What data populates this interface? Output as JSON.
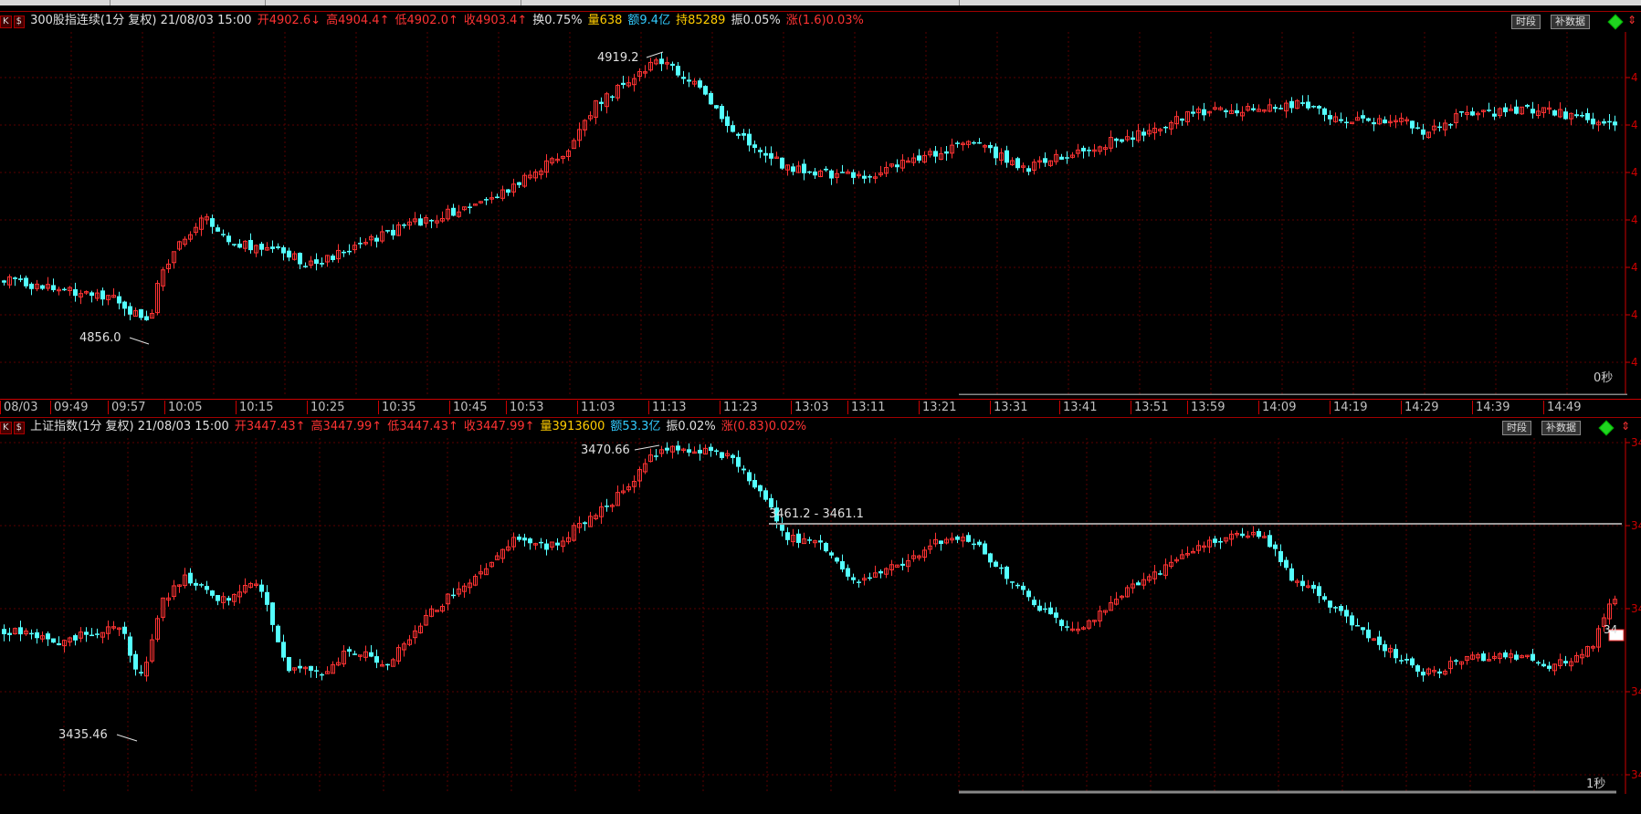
{
  "top_panel": {
    "tags": [
      "K",
      "$"
    ],
    "title": "300股指连续(1分  复权) 21/08/03 15:00",
    "stats": [
      {
        "text": "开4902.6↓",
        "color": "#ff3333"
      },
      {
        "text": "高4904.4↑",
        "color": "#ff3333"
      },
      {
        "text": "低4902.0↑",
        "color": "#ff3333"
      },
      {
        "text": "收4903.4↑",
        "color": "#ff3333"
      },
      {
        "text": "换0.75%",
        "color": "#e0e0e0"
      },
      {
        "text": "量638",
        "color": "#ffcc00"
      },
      {
        "text": "额9.4亿",
        "color": "#33ccff"
      },
      {
        "text": "持85289",
        "color": "#ffcc00"
      },
      {
        "text": "振0.05%",
        "color": "#e0e0e0"
      },
      {
        "text": "涨(1.6)0.03%",
        "color": "#ff3333"
      }
    ],
    "btn_period": "时段",
    "btn_supplement": "补数据",
    "high_label": "4919.2",
    "low_label": "4856.0",
    "corner": "0秒",
    "axis_ticks": [
      "08/03",
      "09:49",
      "09:57",
      "10:05",
      "10:15",
      "10:25",
      "10:35",
      "10:45",
      "10:53",
      "11:03",
      "11:13",
      "11:23",
      "13:03",
      "13:11",
      "13:21",
      "13:31",
      "13:41",
      "13:51",
      "13:59",
      "14:09",
      "14:19",
      "14:29",
      "14:39",
      "14:49"
    ],
    "right_axis_labels": [
      "4",
      "4",
      "4",
      "4",
      "4",
      "4",
      "4"
    ]
  },
  "bottom_panel": {
    "tags": [
      "K",
      "$"
    ],
    "title": "上证指数(1分  复权) 21/08/03 15:00",
    "stats": [
      {
        "text": "开3447.43↑",
        "color": "#ff3333"
      },
      {
        "text": "高3447.99↑",
        "color": "#ff3333"
      },
      {
        "text": "低3447.43↑",
        "color": "#ff3333"
      },
      {
        "text": "收3447.99↑",
        "color": "#ff3333"
      },
      {
        "text": "量3913600",
        "color": "#ffcc00"
      },
      {
        "text": "额53.3亿",
        "color": "#33ccff"
      },
      {
        "text": "振0.02%",
        "color": "#e0e0e0"
      },
      {
        "text": "涨(0.83)0.02%",
        "color": "#ff3333"
      }
    ],
    "btn_period": "时段",
    "btn_supplement": "补数据",
    "high_label": "3470.66",
    "low_label": "3435.46",
    "hline_label": "3461.2 - 3461.1",
    "corner": "1秒",
    "right_axis_labels": [
      "34",
      "34",
      "34",
      "34",
      "34"
    ],
    "price_tag": "34"
  },
  "colors": {
    "up": "#ff3333",
    "down": "#54ffff",
    "grid": "#5a0000",
    "axis": "#cc0000"
  }
}
